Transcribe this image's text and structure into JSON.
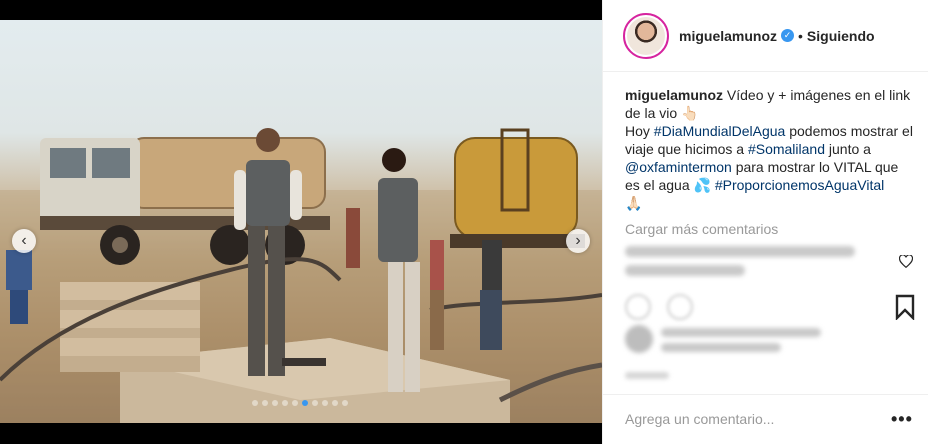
{
  "post": {
    "author": "miguelamunoz",
    "follow_separator": "•",
    "follow_status": "Siguiendo",
    "verified_glyph": "✓",
    "caption": {
      "author": "miguelamunoz",
      "line1": " Vídeo y + imágenes en el link de la vio ",
      "emoji1": "👆🏻",
      "line2": "Hoy ",
      "tag1": "#DiaMundialDelAgua",
      "line3": " podemos mostrar el viaje que hicimos a ",
      "tag2": "#Somaliland",
      "line4": " junto a ",
      "tag3": "@oxfamintermon",
      "line5": " para mostrar lo VITAL que es el agua ",
      "emoji2": "💦",
      "tag4": "#ProporcionemosAguaVital",
      "emoji3": "🙏🏻"
    },
    "load_more_comments": "Cargar más comentarios",
    "comment_placeholder": "Agrega un comentario...",
    "more_glyph": "•••"
  },
  "carousel": {
    "prev_glyph": "‹",
    "next_glyph": "›",
    "dot_count": 10,
    "active_dot": 5
  },
  "icons": {
    "avatar": "avatar-icon",
    "verified": "verified-badge-icon",
    "heart": "heart-icon",
    "bookmark": "bookmark-icon",
    "more": "more-options-icon"
  },
  "colors": {
    "link": "#003569",
    "verified": "#3897f0",
    "muted": "#999999",
    "text": "#262626"
  }
}
